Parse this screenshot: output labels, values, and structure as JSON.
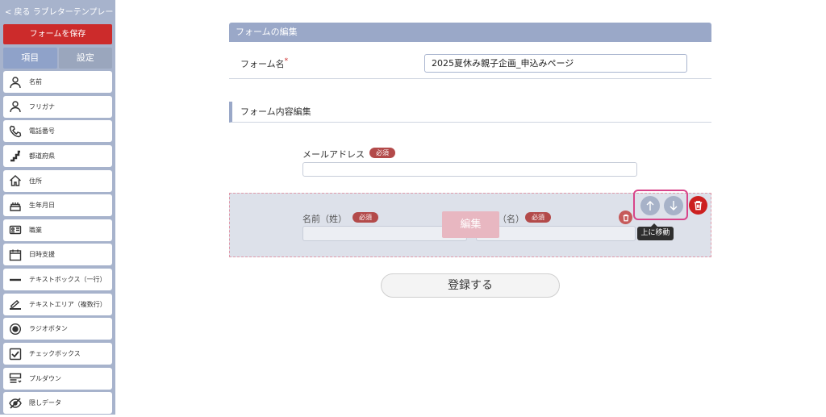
{
  "sidebar": {
    "back_link": "< 戻る ラブレターテンプレート",
    "save_label": "フォームを保存",
    "tabs": [
      {
        "label": "項目",
        "active": true
      },
      {
        "label": "設定",
        "active": false
      }
    ],
    "items": [
      {
        "label": "名前",
        "icon": "person-icon"
      },
      {
        "label": "フリガナ",
        "icon": "person-icon"
      },
      {
        "label": "電話番号",
        "icon": "phone-icon"
      },
      {
        "label": "都道府県",
        "icon": "map-pin-icon"
      },
      {
        "label": "住所",
        "icon": "home-icon"
      },
      {
        "label": "生年月日",
        "icon": "cake-icon"
      },
      {
        "label": "職業",
        "icon": "id-card-icon"
      },
      {
        "label": "日時支援",
        "icon": "calendar-icon"
      },
      {
        "label": "テキストボックス（一行）",
        "icon": "line-icon"
      },
      {
        "label": "テキストエリア（複数行）",
        "icon": "pen-icon"
      },
      {
        "label": "ラジオボタン",
        "icon": "radio-icon"
      },
      {
        "label": "チェックボックス",
        "icon": "checkbox-icon"
      },
      {
        "label": "プルダウン",
        "icon": "dropdown-icon"
      },
      {
        "label": "隠しデータ",
        "icon": "eye-off-icon"
      }
    ]
  },
  "main": {
    "section_title": "フォームの編集",
    "form_name_label": "フォーム名",
    "form_name_required_mark": "*",
    "form_name_value": "2025夏休み親子企画_申込みページ",
    "content_section_title": "フォーム内容編集",
    "email_field": {
      "label": "メールアドレス",
      "badge": "必須"
    },
    "name_field": {
      "last_label": "名前（姓）",
      "last_badge": "必須",
      "first_label": "（名）",
      "first_badge": "必須",
      "edit_overlay": "編集"
    },
    "tooltip": "上に移動",
    "submit_label": "登録する"
  },
  "colors": {
    "sidebar_bg": "#a7b3cc",
    "save_button": "#cc2b2b",
    "section_header": "#9aa8c8",
    "badge": "#b34a4a",
    "highlight": "#d8458a",
    "delete": "#cc2020"
  }
}
